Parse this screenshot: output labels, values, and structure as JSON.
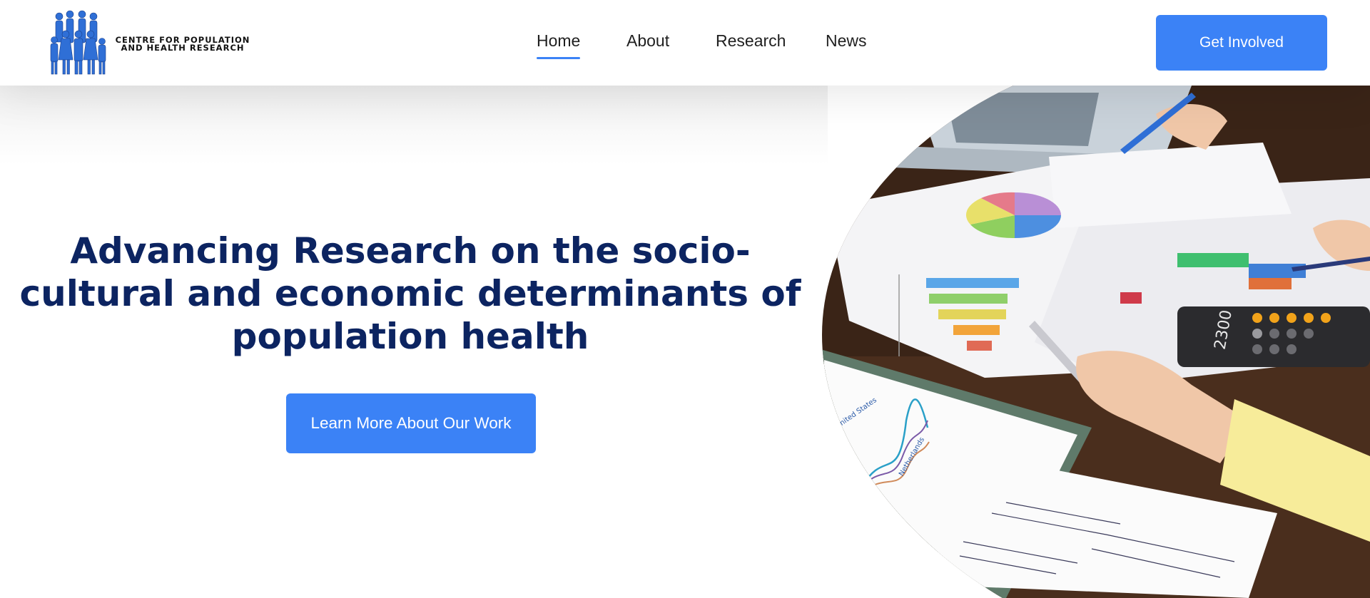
{
  "brand": {
    "name_line1": "CENTRE FOR POPULATION",
    "name_line2": "AND HEALTH RESEARCH",
    "logo_icon": "people-family-icon",
    "color": "#2f6fd6"
  },
  "nav": {
    "items": [
      {
        "label": "Home",
        "active": true
      },
      {
        "label": "About",
        "active": false
      },
      {
        "label": "Research",
        "active": false
      },
      {
        "label": "News",
        "active": false
      }
    ]
  },
  "header": {
    "cta_label": "Get Involved"
  },
  "hero": {
    "title": "Advancing Research on the socio-cultural and economic determinants of population health",
    "cta_label": "Learn More About Our Work"
  },
  "colors": {
    "accent": "#3b82f6",
    "title": "#0c2461"
  },
  "photo": {
    "calculator_display": "2300",
    "chart_label_1": "United States",
    "chart_label_2": "Netherlands"
  }
}
